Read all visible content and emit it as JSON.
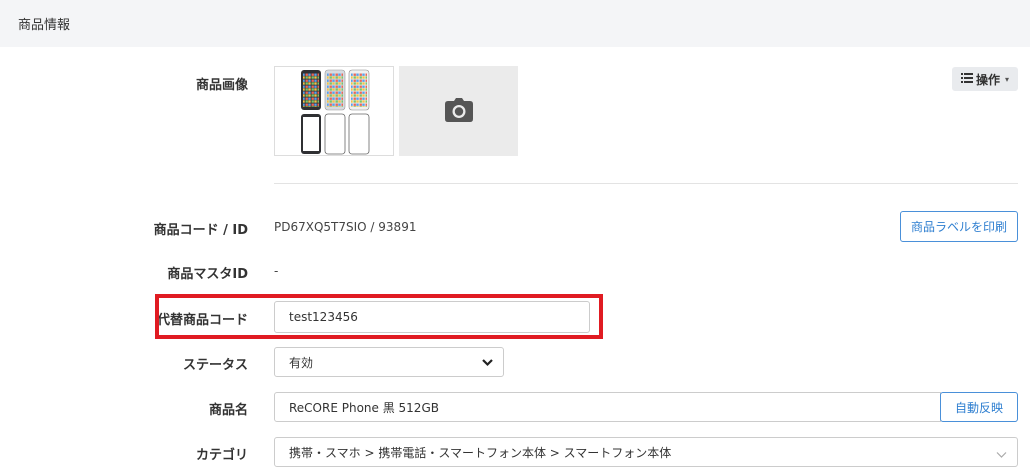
{
  "header": {
    "title": "商品情報"
  },
  "image_section": {
    "label": "商品画像",
    "ops_label": "操作"
  },
  "product_code": {
    "label": "商品コード / ID",
    "value": "PD67XQ5T7SIO / 93891",
    "print_label_button": "商品ラベルを印刷"
  },
  "master_id": {
    "label": "商品マスタID",
    "value": "-"
  },
  "alt_code": {
    "label": "代替商品コード",
    "value": "test123456"
  },
  "status": {
    "label": "ステータス",
    "selected": "有効"
  },
  "product_name": {
    "label": "商品名",
    "value": "ReCORE Phone 黒 512GB",
    "auto_button": "自動反映"
  },
  "category": {
    "label": "カテゴリ",
    "value": "携帯・スマホ > 携帯電話・スマートフォン本体 > スマートフォン本体"
  },
  "colors": {
    "highlight": "#e01b22",
    "accent": "#2f7fd0",
    "header_bg": "#f4f5f7"
  }
}
